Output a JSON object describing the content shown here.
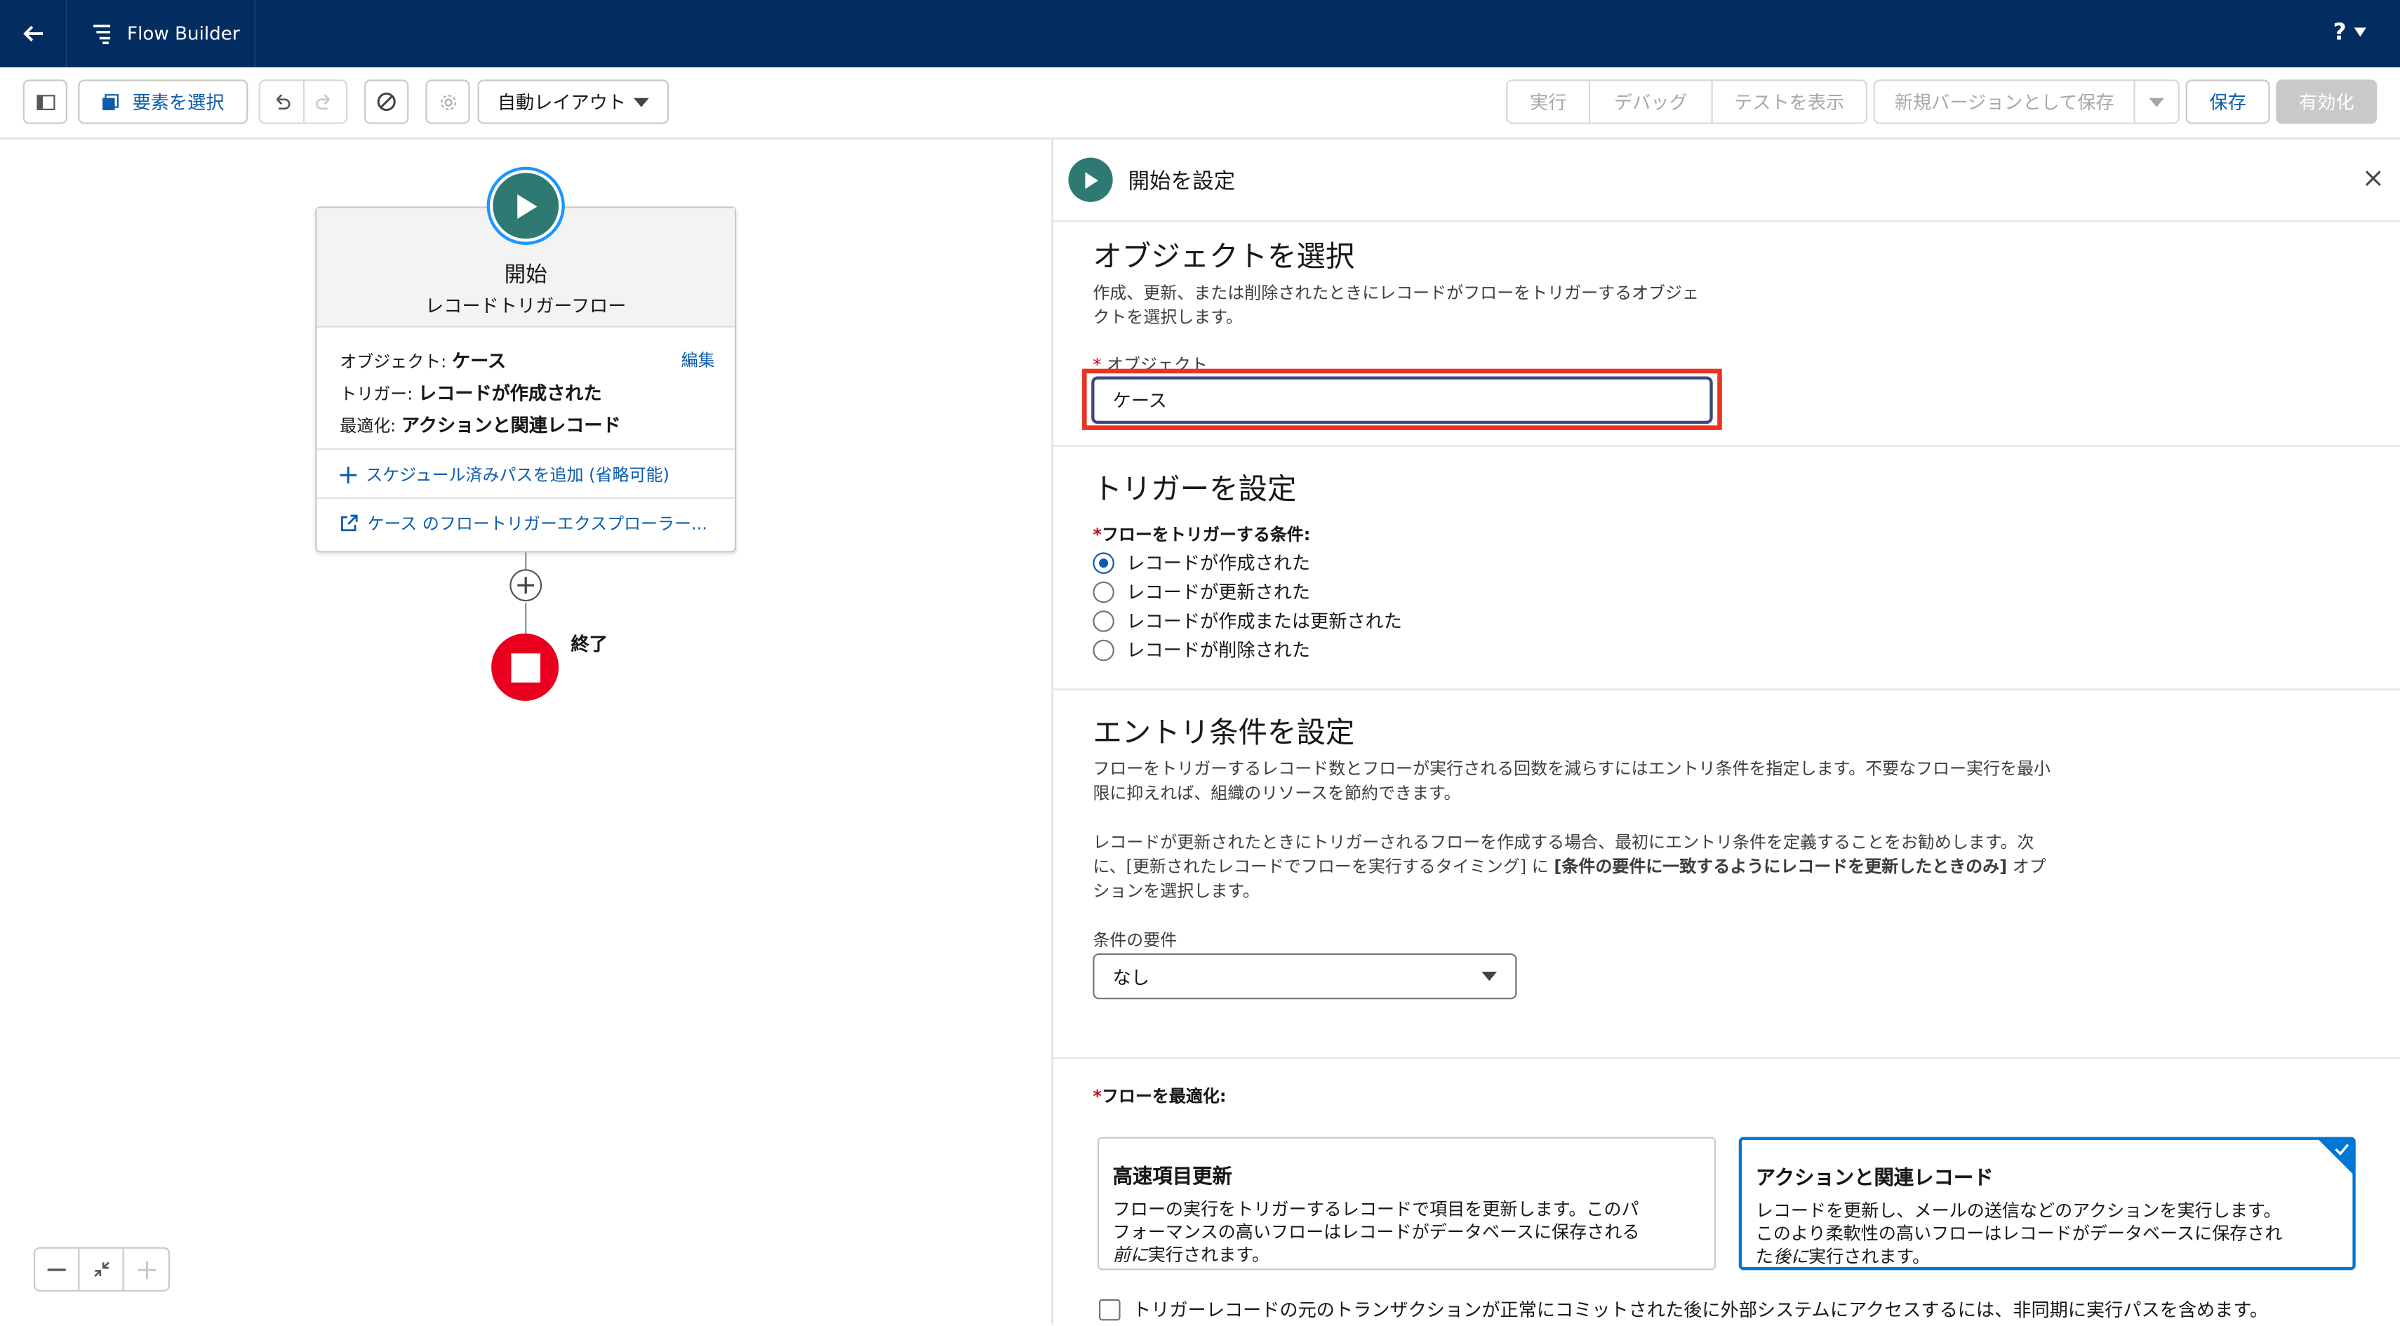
{
  "header": {
    "app_title": "Flow Builder",
    "help_label": "?"
  },
  "toolbar": {
    "select_elements": "要素を選択",
    "layout": "自動レイアウト",
    "run": "実行",
    "debug": "デバッグ",
    "view_tests": "テストを表示",
    "save_new_version": "新規バージョンとして保存",
    "save": "保存",
    "activate": "有効化"
  },
  "canvas": {
    "start": {
      "title": "開始",
      "subtitle": "レコードトリガーフロー",
      "object_label": "オブジェクト:",
      "object_value": "ケース",
      "edit": "編集",
      "trigger_label": "トリガー:",
      "trigger_value": "レコードが作成された",
      "optimize_label": "最適化:",
      "optimize_value": "アクションと関連レコード",
      "add_scheduled_path": "スケジュール済みパスを追加 (省略可能)",
      "explorer_link": "ケース のフロートリガーエクスプローラー..."
    },
    "end_label": "終了"
  },
  "panel": {
    "title": "開始を設定",
    "object_section": {
      "heading": "オブジェクトを選択",
      "desc_line1": "作成、更新、または削除されたときにレコードがフローをトリガーするオブジェ",
      "desc_line2": "クトを選択します。",
      "field_label": "オブジェクト",
      "field_value": "ケース"
    },
    "trigger_section": {
      "heading": "トリガーを設定",
      "label": "フローをトリガーする条件:",
      "options": [
        "レコードが作成された",
        "レコードが更新された",
        "レコードが作成または更新された",
        "レコードが削除された"
      ],
      "selected_index": 0
    },
    "entry_section": {
      "heading": "エントリ条件を設定",
      "p1_line1": "フローをトリガーするレコード数とフローが実行される回数を減らすにはエントリ条件を指定します。不要なフロー実行を最小",
      "p1_line2": "限に抑えれば、組織のリソースを節約できます。",
      "p2_line1": "レコードが更新されたときにトリガーされるフローを作成する場合、最初にエントリ条件を定義することをお勧めします。次",
      "p2_line2_a": "に、[更新されたレコードでフローを実行するタイミング] に ",
      "p2_line2_b": "[条件の要件に一致するようにレコードを更新したときのみ]",
      "p2_line2_c": " オプ",
      "p2_line3": "ションを選択します。",
      "req_label": "条件の要件",
      "req_value": "なし"
    },
    "optimize_section": {
      "label": "フローを最適化:",
      "fast": {
        "title": "高速項目更新",
        "line1": "フローの実行をトリガーするレコードで項目を更新します。このパ",
        "line2": "フォーマンスの高いフローはレコードがデータベースに保存される",
        "line3a": "前に",
        "line3b": "実行されます。"
      },
      "actions": {
        "title": "アクションと関連レコード",
        "line1": "レコードを更新し、メールの送信などのアクションを実行します。",
        "line2": "このより柔軟性の高いフローはレコードがデータベースに保存され",
        "line3a": "た",
        "line3b": "後に",
        "line3c": "実行されます。"
      },
      "async_checkbox": "トリガーレコードの元のトランザクションが正常にコミットされた後に外部システムにアクセスするには、非同期に実行パスを含めます。"
    }
  },
  "colors": {
    "header_bg": "#032d60",
    "start_icon": "#2e7a72",
    "end_icon": "#ea001e",
    "highlight": "#ea3323",
    "brand_blue": "#0176d3"
  }
}
